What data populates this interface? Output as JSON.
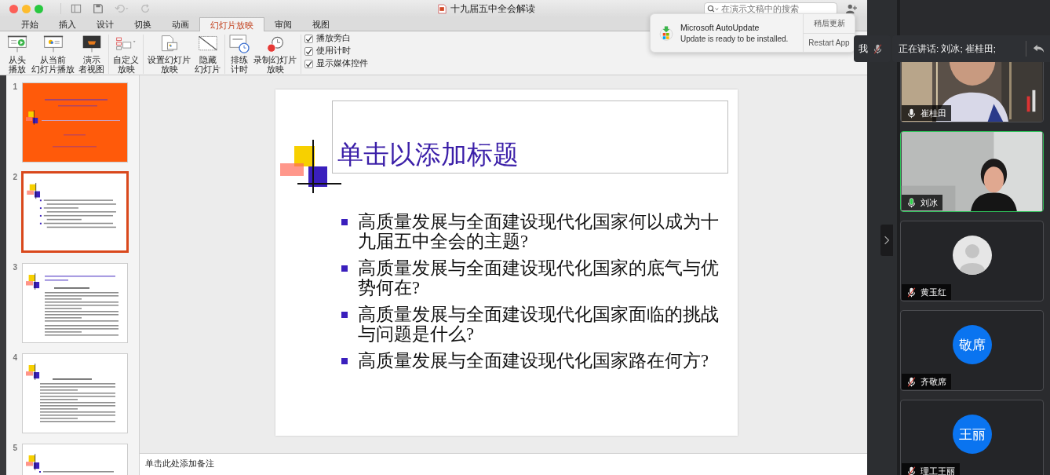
{
  "window": {
    "title": "十九届五中全会解读",
    "search": {
      "placeholder": "在演示文稿中的搜索"
    }
  },
  "tabs": [
    {
      "label": "开始",
      "selected": false
    },
    {
      "label": "插入",
      "selected": false
    },
    {
      "label": "设计",
      "selected": false
    },
    {
      "label": "切换",
      "selected": false
    },
    {
      "label": "动画",
      "selected": false
    },
    {
      "label": "幻灯片放映",
      "selected": true
    },
    {
      "label": "审阅",
      "selected": false
    },
    {
      "label": "视图",
      "selected": false
    }
  ],
  "ribbon": {
    "groups": [
      [
        {
          "kind": "play-start",
          "label_lines": [
            "从头",
            "播放"
          ]
        },
        {
          "kind": "play-current",
          "label_lines": [
            "从当前",
            "幻灯片播放"
          ]
        },
        {
          "kind": "presenter",
          "label_lines": [
            "演示",
            "者视图"
          ]
        }
      ],
      [
        {
          "kind": "custom",
          "label_lines": [
            "自定义",
            "放映"
          ]
        }
      ],
      [
        {
          "kind": "setup",
          "label_lines": [
            "设置幻灯片",
            "放映"
          ]
        },
        {
          "kind": "hide",
          "label_lines": [
            "隐藏",
            "幻灯片"
          ]
        }
      ],
      [
        {
          "kind": "rehearse",
          "label_lines": [
            "排练",
            "计时"
          ]
        },
        {
          "kind": "record",
          "label_lines": [
            "录制幻灯片",
            "放映"
          ]
        }
      ]
    ],
    "options": [
      {
        "label": "播放旁白",
        "checked": true
      },
      {
        "label": "使用计时",
        "checked": true
      },
      {
        "label": "显示媒体控件",
        "checked": true
      }
    ]
  },
  "slides": [
    {
      "number": "1",
      "kind": "title",
      "selected": false
    },
    {
      "number": "2",
      "kind": "bullets",
      "selected": true
    },
    {
      "number": "3",
      "kind": "text",
      "selected": false
    },
    {
      "number": "4",
      "kind": "list",
      "selected": false
    },
    {
      "number": "5",
      "kind": "bullets",
      "selected": false
    }
  ],
  "slide": {
    "title_placeholder": "单击以添加标题",
    "bullets": [
      "高质量发展与全面建设现代化国家何以成为十九届五中全会的主题?",
      "高质量发展与全面建设现代化国家的底气与优势何在?",
      "高质量发展与全面建设现代化国家面临的挑战与问题是什么?",
      "高质量发展与全面建设现代化国家路在何方?"
    ]
  },
  "notes": {
    "placeholder": "单击此处添加备注"
  },
  "notification": {
    "title": "Microsoft AutoUpdate",
    "message": "Update is ready to be installed.",
    "buttons": [
      "稍后更新",
      "Restart App"
    ]
  },
  "meeting": {
    "me": {
      "label": "我",
      "muted": true
    },
    "speaking": "正在讲话: 刘冰; 崔桂田;",
    "participants": [
      {
        "name": "崔桂田",
        "kind": "video",
        "muted": false,
        "speaking": false
      },
      {
        "name": "刘冰",
        "kind": "video",
        "muted": false,
        "speaking": true
      },
      {
        "name": "黄玉红",
        "kind": "default-avatar",
        "muted": true,
        "speaking": false
      },
      {
        "name": "齐敬席",
        "kind": "initials",
        "initials": "敬席",
        "muted": true,
        "speaking": false
      },
      {
        "name": "理工王丽",
        "kind": "initials",
        "initials": "王丽",
        "muted": true,
        "speaking": false
      }
    ]
  }
}
